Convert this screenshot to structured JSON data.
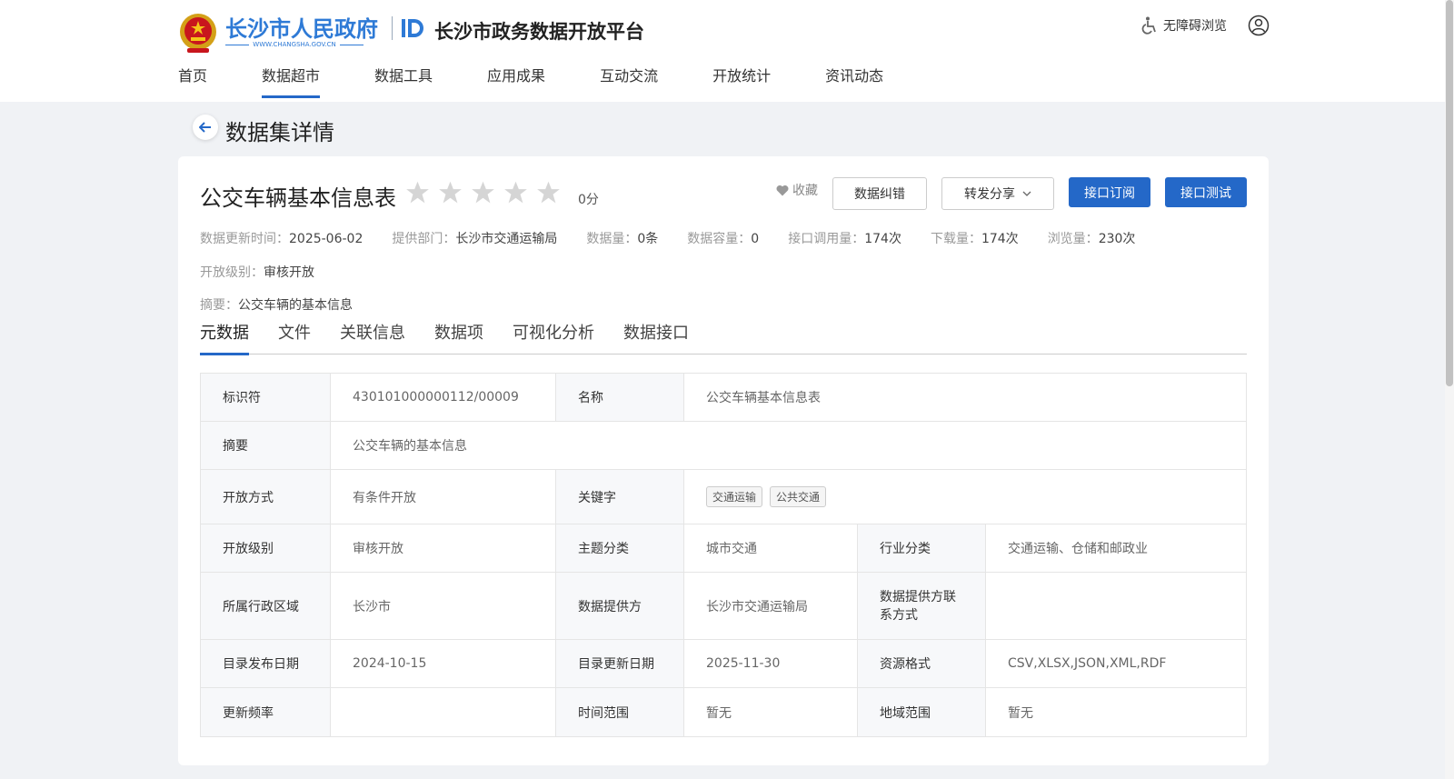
{
  "header": {
    "gov_name": "长沙市人民政府",
    "gov_url": "WWW.CHANGSHA.GOV.CN",
    "platform_name": "长沙市政务数据开放平台",
    "accessibility_label": "无障碍浏览"
  },
  "nav": [
    "首页",
    "数据超市",
    "数据工具",
    "应用成果",
    "互动交流",
    "开放统计",
    "资讯动态"
  ],
  "nav_active": "数据超市",
  "page_title": "数据集详情",
  "dataset": {
    "title": "公交车辆基本信息表",
    "rating": 0,
    "score_text": "0分",
    "favorite_label": "收藏",
    "buttons": {
      "correction": "数据纠错",
      "share": "转发分享",
      "subscribe": "接口订阅",
      "test": "接口测试"
    },
    "meta": [
      {
        "k": "数据更新时间：",
        "v": "2025-06-02"
      },
      {
        "k": "提供部门：",
        "v": "长沙市交通运输局"
      },
      {
        "k": "数据量：",
        "v": "0条"
      },
      {
        "k": "数据容量：",
        "v": "0"
      },
      {
        "k": "接口调用量：",
        "v": "174次"
      },
      {
        "k": "下载量：",
        "v": "174次"
      },
      {
        "k": "浏览量：",
        "v": "230次"
      }
    ],
    "open_level": {
      "k": "开放级别：",
      "v": "审核开放"
    },
    "summary": {
      "k": "摘要：",
      "v": "公交车辆的基本信息"
    }
  },
  "tabs": [
    "元数据",
    "文件",
    "关联信息",
    "数据项",
    "可视化分析",
    "数据接口"
  ],
  "tab_active": "元数据",
  "table": {
    "identifier": {
      "k": "标识符",
      "v": "430101000000112/00009"
    },
    "name": {
      "k": "名称",
      "v": "公交车辆基本信息表"
    },
    "summary": {
      "k": "摘要",
      "v": "公交车辆的基本信息"
    },
    "open_method": {
      "k": "开放方式",
      "v": "有条件开放"
    },
    "keywords": {
      "k": "关键字",
      "tags": [
        "交通运输",
        "公共交通"
      ]
    },
    "open_level": {
      "k": "开放级别",
      "v": "审核开放"
    },
    "theme": {
      "k": "主题分类",
      "v": "城市交通"
    },
    "industry": {
      "k": "行业分类",
      "v": "交通运输、仓储和邮政业"
    },
    "region": {
      "k": "所属行政区域",
      "v": "长沙市"
    },
    "provider": {
      "k": "数据提供方",
      "v": "长沙市交通运输局"
    },
    "provider_contact": {
      "k": "数据提供方联系方式",
      "v": ""
    },
    "publish_date": {
      "k": "目录发布日期",
      "v": "2024-10-15"
    },
    "update_date": {
      "k": "目录更新日期",
      "v": "2025-11-30"
    },
    "format": {
      "k": "资源格式",
      "v": "CSV,XLSX,JSON,XML,RDF"
    },
    "frequency": {
      "k": "更新频率",
      "v": ""
    },
    "time_range": {
      "k": "时间范围",
      "v": "暂无"
    },
    "geo_range": {
      "k": "地域范围",
      "v": "暂无"
    }
  }
}
